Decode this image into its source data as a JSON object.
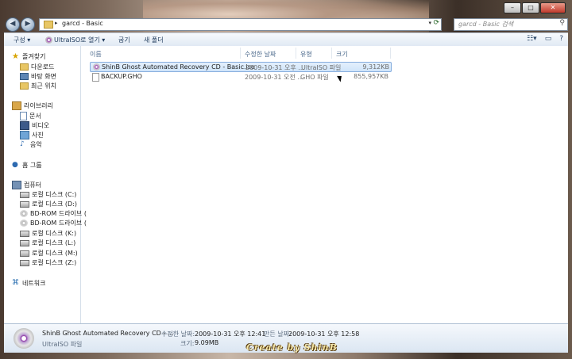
{
  "address": {
    "path": "garcd - Basic"
  },
  "search": {
    "placeholder": "garcd - Basic 검색"
  },
  "toolbar": {
    "organize": "구성 ▾",
    "open_with": "UltraISO로 열기 ▾",
    "burn": "굽기",
    "new_folder": "새 폴더"
  },
  "nav": {
    "favorites": "즐겨찾기",
    "downloads": "다운로드",
    "desktop": "바탕 화면",
    "recent": "최근 위치",
    "libraries": "라이브러리",
    "documents": "문서",
    "videos": "비디오",
    "pictures": "사진",
    "music": "음악",
    "homegroup": "홈 그룹",
    "computer": "컴퓨터",
    "drives": [
      "로컬 디스크 (C:)",
      "로컬 디스크 (D:)",
      "BD-ROM 드라이브 (",
      "BD-ROM 드라이브 (",
      "로컬 디스크 (K:)",
      "로컬 디스크 (L:)",
      "로컬 디스크 (M:)",
      "로컬 디스크 (Z:)"
    ],
    "network": "네트워크"
  },
  "columns": {
    "name": "이름",
    "date": "수정한 날짜",
    "type": "유형",
    "size": "크기"
  },
  "files": [
    {
      "name": "ShinB Ghost Automated Recovery CD - Basic.iso",
      "date": "2009-10-31 오후 ...",
      "type": "UltraISO 파일",
      "size": "9,312KB",
      "icon": "iso-disc-icon"
    },
    {
      "name": "BACKUP.GHO",
      "date": "2009-10-31 오전 ...",
      "type": "GHO 파일",
      "size": "855,957KB",
      "icon": "generic-file-icon"
    }
  ],
  "details": {
    "name": "ShinB Ghost Automated Recovery CD - ...",
    "type": "UltraISO 파일",
    "modified_label": "수정한 날짜:",
    "modified": "2009-10-31 오후 12:41",
    "created_label": "만든 날짜:",
    "created": "2009-10-31 오후 12:58",
    "size_label": "크기:",
    "size": "9.09MB"
  },
  "watermark": "Create by ShinB",
  "colors": {
    "selection": "#cfe4fa",
    "selection_border": "#84acdd",
    "toolbar": "#dfe8f3"
  }
}
